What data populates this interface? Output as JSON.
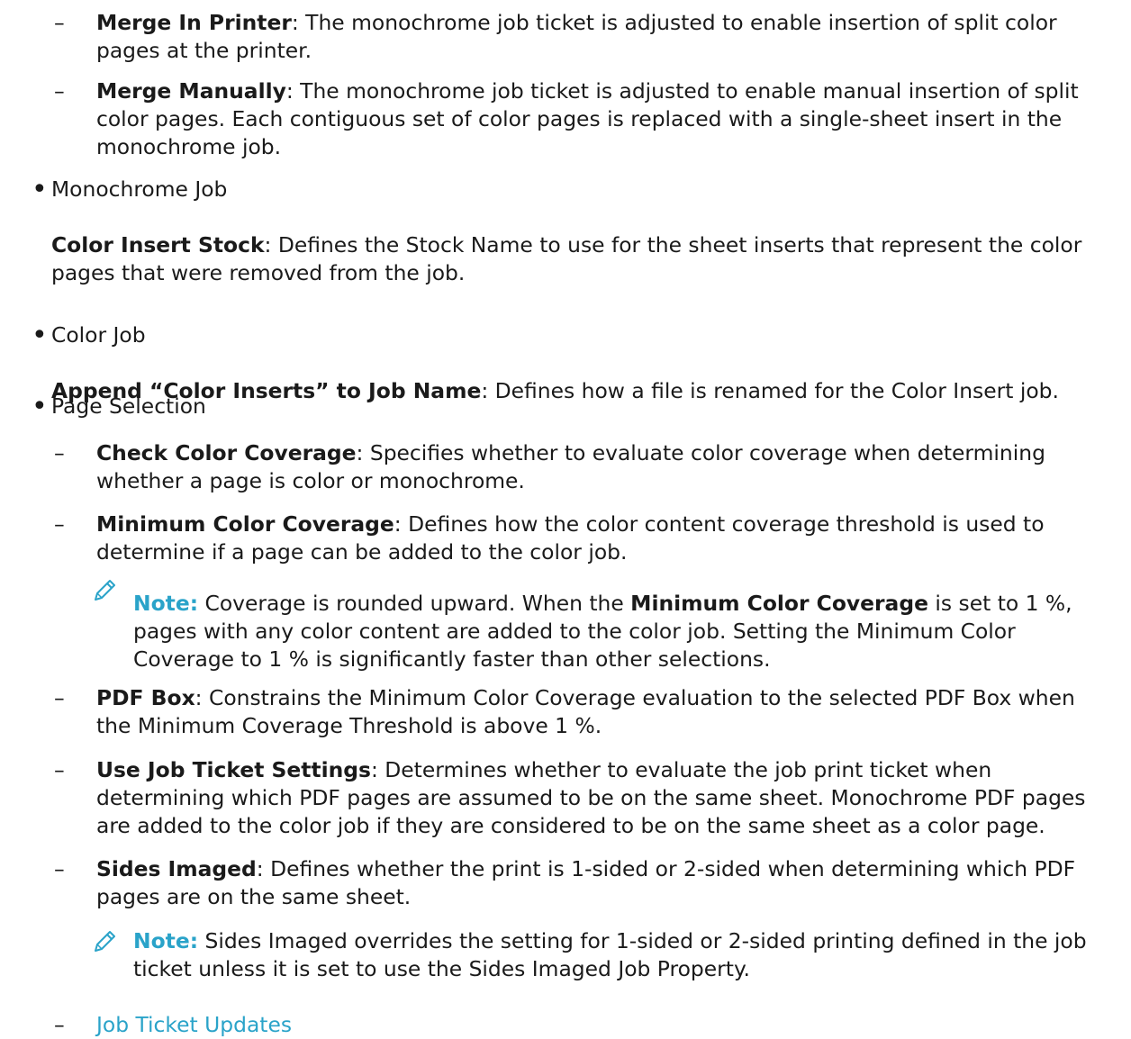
{
  "merge_printer": {
    "term": "Merge In Printer",
    "desc": ": The monochrome job ticket is adjusted to enable insertion of split color pages at the printer."
  },
  "merge_manually": {
    "term": "Merge Manually",
    "desc": ": The monochrome job ticket is adjusted to enable manual insertion of split color pages. Each contiguous set of color pages is replaced with a single-sheet insert in the monochrome job."
  },
  "monochrome_job": {
    "label": "Monochrome Job",
    "term": "Color Insert Stock",
    "desc": ": Defines the Stock Name to use for the sheet inserts that represent the color pages that were removed from the job."
  },
  "color_job": {
    "label": "Color Job",
    "term": "Append “Color Inserts” to Job Name",
    "desc": ": Defines how a file is renamed for the Color Insert job."
  },
  "page_selection": {
    "label": "Page Selection",
    "check_coverage": {
      "term": "Check Color Coverage",
      "desc": ": Specifies whether to evaluate color coverage when determining whether a page is color or monochrome."
    },
    "min_coverage": {
      "term": "Minimum Color Coverage",
      "desc": ": Defines how the color content coverage threshold is used to determine if a page can be added to the color job."
    },
    "note1": {
      "label": "Note:",
      "text_a": " Coverage is rounded upward. When the ",
      "bold": "Minimum Color Coverage",
      "text_b": " is set to 1 %, pages with any color content are added to the color job. Setting the Minimum Color Coverage to 1 % is significantly faster than other selections."
    },
    "pdf_box": {
      "term": "PDF Box",
      "desc": ": Constrains the Minimum Color Coverage evaluation to the selected PDF Box when the Minimum Coverage Threshold is above 1 %."
    },
    "job_ticket_settings": {
      "term": "Use Job Ticket Settings",
      "desc": ": Determines whether to evaluate the job print ticket when determining which PDF pages are assumed to be on the same sheet. Monochrome PDF pages are added to the color job if they are considered to be on the same sheet as a color page."
    },
    "sides_imaged": {
      "term": "Sides Imaged",
      "desc": ": Defines whether the print is 1-sided or 2-sided when determining which PDF pages are on the same sheet."
    },
    "note2": {
      "label": "Note:",
      "text": " Sides Imaged overrides the setting for 1-sided or 2-sided printing defined in the job ticket unless it is set to use the Sides Imaged Job Property."
    },
    "link": "Job Ticket Updates"
  },
  "dash": "–",
  "bullet": "•",
  "colors": {
    "accent": "#2aa3c9",
    "text": "#1a1a1a"
  },
  "icon": "pencil-icon"
}
